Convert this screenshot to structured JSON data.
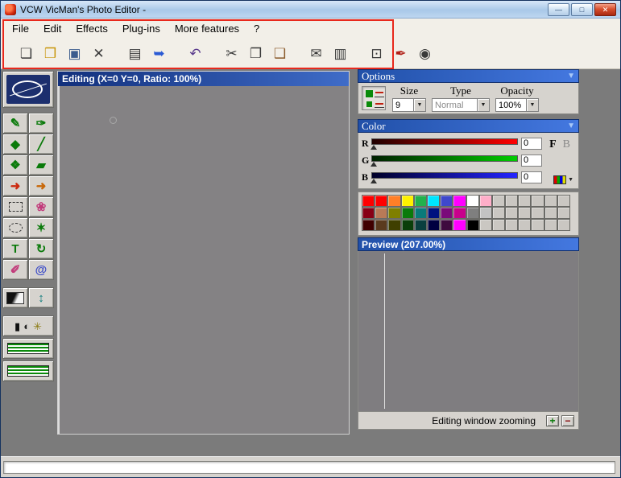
{
  "window": {
    "title": "VCW VicMan's Photo Editor -",
    "controls": {
      "minimize": "—",
      "maximize": "□",
      "close": "✕"
    }
  },
  "icons": {
    "dropdown_arrow": "▼",
    "collapse": "▼"
  },
  "menu": {
    "items": [
      "File",
      "Edit",
      "Effects",
      "Plug-ins",
      "More features",
      "?"
    ]
  },
  "toolbar": {
    "buttons": [
      {
        "name": "new",
        "glyph": "❏",
        "c": "dark"
      },
      {
        "name": "open",
        "glyph": "❒",
        "c": "yellow"
      },
      {
        "name": "save",
        "glyph": "▣",
        "c": "steel"
      },
      {
        "name": "delete",
        "glyph": "✕",
        "c": "dark"
      },
      {
        "name": "print",
        "glyph": "▤",
        "c": "dark",
        "gap": true
      },
      {
        "name": "print-preview",
        "glyph": "➥",
        "c": "blue"
      },
      {
        "name": "undo",
        "glyph": "↶",
        "c": "purple",
        "gap": true
      },
      {
        "name": "cut",
        "glyph": "✂",
        "c": "dark",
        "gap": true
      },
      {
        "name": "copy",
        "glyph": "❐",
        "c": "dark"
      },
      {
        "name": "paste",
        "glyph": "❑",
        "c": "brown"
      },
      {
        "name": "email",
        "glyph": "✉",
        "c": "dark",
        "gap": true
      },
      {
        "name": "notes",
        "glyph": "▥",
        "c": "dark"
      },
      {
        "name": "capture",
        "glyph": "⊡",
        "c": "dark",
        "gap": true
      },
      {
        "name": "pen",
        "glyph": "✒",
        "c": "redpen"
      },
      {
        "name": "webcam",
        "glyph": "◉",
        "c": "dark"
      }
    ]
  },
  "tools": {
    "buttons": [
      {
        "name": "pencil",
        "glyph": "✎",
        "c": "green"
      },
      {
        "name": "brush",
        "glyph": "✑",
        "c": "green"
      },
      {
        "name": "shape",
        "glyph": "◆",
        "c": "green"
      },
      {
        "name": "line",
        "glyph": "╱",
        "c": "green"
      },
      {
        "name": "spray",
        "glyph": "❖",
        "c": "green"
      },
      {
        "name": "fill",
        "glyph": "▰",
        "c": "green"
      },
      {
        "name": "gradient-fill",
        "glyph": "➜",
        "c": "red"
      },
      {
        "name": "pattern-fill",
        "glyph": "➜",
        "c": "orange"
      },
      {
        "name": "select-rectangle",
        "shape": "selrect"
      },
      {
        "name": "clone-brush",
        "glyph": "❀",
        "c": "pink"
      },
      {
        "name": "select-ellipse",
        "shape": "selellipse"
      },
      {
        "name": "magic-wand",
        "glyph": "✶",
        "c": "green"
      },
      {
        "name": "text",
        "glyph": "T",
        "c": "green"
      },
      {
        "name": "rotate",
        "glyph": "↻",
        "c": "green"
      },
      {
        "name": "eraser",
        "glyph": "✐",
        "c": "pink"
      },
      {
        "name": "swirl",
        "glyph": "@",
        "c": "blue2"
      }
    ],
    "extra": [
      {
        "name": "gradient",
        "shape": "gradient"
      },
      {
        "name": "resize",
        "glyph": "↕",
        "c": "teal"
      }
    ],
    "adjust_glyphs": [
      "▮",
      "◐",
      "✳"
    ],
    "stripe_buttons": [
      "interlace",
      "scanlines"
    ]
  },
  "editing_window": {
    "title": "Editing (X=0 Y=0, Ratio: 100%)"
  },
  "options_panel": {
    "title": "Options",
    "size_label": "Size",
    "size_value": "9",
    "type_label": "Type",
    "type_value": "Normal",
    "opacity_label": "Opacity",
    "opacity_value": "100%"
  },
  "color_panel": {
    "title": "Color",
    "r_label": "R",
    "r_value": "0",
    "g_label": "G",
    "g_value": "0",
    "b_label": "B",
    "b_value": "0",
    "foreground_label": "F",
    "background_label": "B"
  },
  "palette": {
    "rows": [
      [
        "#ff0000",
        "#ff0000",
        "#ff7f27",
        "#fff200",
        "#22b14c",
        "#00e5ff",
        "#3f48cc",
        "#ff00ff",
        "#ffffff",
        "#ffaec9",
        "",
        "",
        "",
        "",
        "",
        ""
      ],
      [
        "#880015",
        "#b97a57",
        "#7f7f00",
        "#0a7a0a",
        "#0a7a7a",
        "#00127f",
        "#7a0a7a",
        "#c8008c",
        "#7f7f7f",
        "#c3c3c3",
        "",
        "",
        "",
        "",
        "",
        ""
      ],
      [
        "#400000",
        "#5a3a1e",
        "#3f3f00",
        "#0a3f0a",
        "#0a3f3f",
        "#000040",
        "#3f0a3f",
        "#ff00ff",
        "#000000",
        "",
        "",
        "",
        "",
        "",
        "",
        ""
      ]
    ]
  },
  "preview_panel": {
    "title": "Preview (207.00%)",
    "zoom_label": "Editing window zooming",
    "zoom_in": "+",
    "zoom_out": "−"
  }
}
